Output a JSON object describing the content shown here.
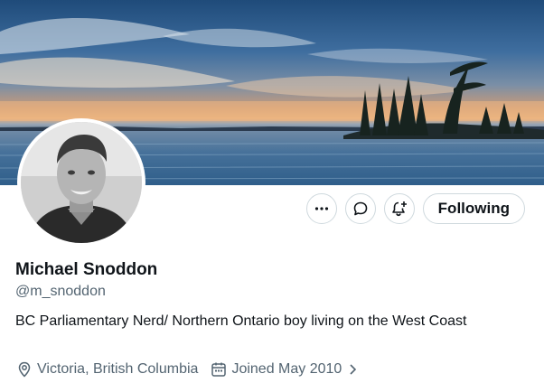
{
  "profile": {
    "name": "Michael Snoddon",
    "handle": "@m_snoddon",
    "bio": "BC Parliamentary Nerd/ Northern Ontario boy living on the West Coast",
    "location": "Victoria, British Columbia",
    "joined": "Joined May 2010"
  },
  "actions": {
    "more_icon": "more-icon",
    "message_icon": "message-icon",
    "notify_icon": "notification-bell-icon",
    "follow_label": "Following"
  },
  "colors": {
    "text_primary": "#0f1419",
    "text_secondary": "#536471",
    "border": "#cfd9de"
  }
}
